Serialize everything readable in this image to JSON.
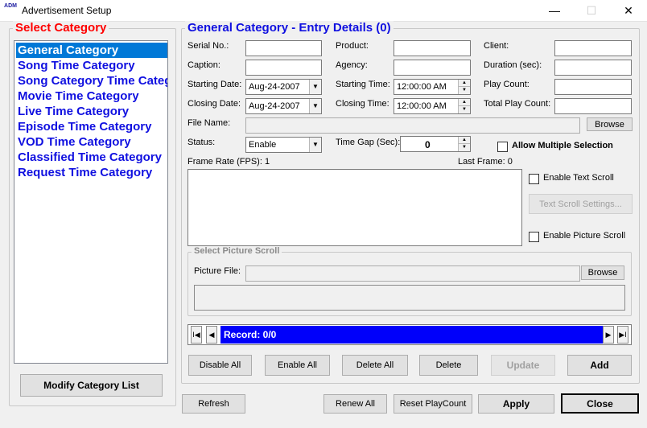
{
  "window": {
    "app_icon_text": "ADM",
    "title": "Advertisement Setup",
    "minimize_glyph": "—",
    "maximize_glyph": "☐",
    "close_glyph": "✕"
  },
  "category_panel": {
    "title": "Select Category",
    "title_color": "#ff0000",
    "items": [
      {
        "label": "General Category"
      },
      {
        "label": "Song Time Category"
      },
      {
        "label": "Song Category Time Category"
      },
      {
        "label": "Movie Time Category"
      },
      {
        "label": "Live Time Category"
      },
      {
        "label": "Episode Time Category"
      },
      {
        "label": "VOD Time Category"
      },
      {
        "label": "Classified Time Category"
      },
      {
        "label": "Request Time Category"
      }
    ],
    "selected_index": 0,
    "modify_button": "Modify Category List"
  },
  "entry": {
    "title": "General Category - Entry Details (0)",
    "title_color": "#1010e0",
    "serial_label": "Serial No.:",
    "serial_value": "",
    "caption_label": "Caption:",
    "caption_value": "",
    "starting_date_label": "Starting Date:",
    "starting_date_value": "Aug-24-2007",
    "closing_date_label": "Closing Date:",
    "closing_date_value": "Aug-24-2007",
    "product_label": "Product:",
    "product_value": "",
    "agency_label": "Agency:",
    "agency_value": "",
    "starting_time_label": "Starting Time:",
    "starting_time_value": "12:00:00 AM",
    "closing_time_label": "Closing Time:",
    "closing_time_value": "12:00:00 AM",
    "client_label": "Client:",
    "client_value": "",
    "duration_label": "Duration (sec):",
    "duration_value": "",
    "play_count_label": "Play Count:",
    "play_count_value": "",
    "total_play_count_label": "Total Play Count:",
    "total_play_count_value": "",
    "file_name_label": "File Name:",
    "file_name_value": "",
    "browse_label": "Browse",
    "status_label": "Status:",
    "status_value": "Enable",
    "time_gap_label": "Time Gap (Sec):",
    "time_gap_value": "0",
    "allow_multiple_label": "Allow Multiple Selection",
    "allow_multiple_checked": false,
    "frame_rate_label": "Frame Rate (FPS): 1",
    "last_frame_label": "Last Frame: 0",
    "enable_text_scroll_label": "Enable Text Scroll",
    "text_scroll_settings_label": "Text Scroll Settings...",
    "enable_picture_scroll_label": "Enable Picture Scroll",
    "picture_scroll_title": "Select Picture Scroll",
    "picture_file_label": "Picture File:",
    "picture_file_value": "",
    "picture_browse_label": "Browse"
  },
  "navigator": {
    "first_glyph": "I◀",
    "prev_glyph": "◀",
    "next_glyph": "▶",
    "last_glyph": "▶I",
    "record_text": "Record: 0/0",
    "record_color": "#0000fa"
  },
  "actions": {
    "disable_all": "Disable All",
    "enable_all": "Enable All",
    "delete_all": "Delete All",
    "delete": "Delete",
    "update": "Update",
    "add": "Add"
  },
  "footer": {
    "refresh": "Refresh",
    "renew_all": "Renew All",
    "reset_playcount": "Reset PlayCount",
    "apply": "Apply",
    "close": "Close"
  }
}
